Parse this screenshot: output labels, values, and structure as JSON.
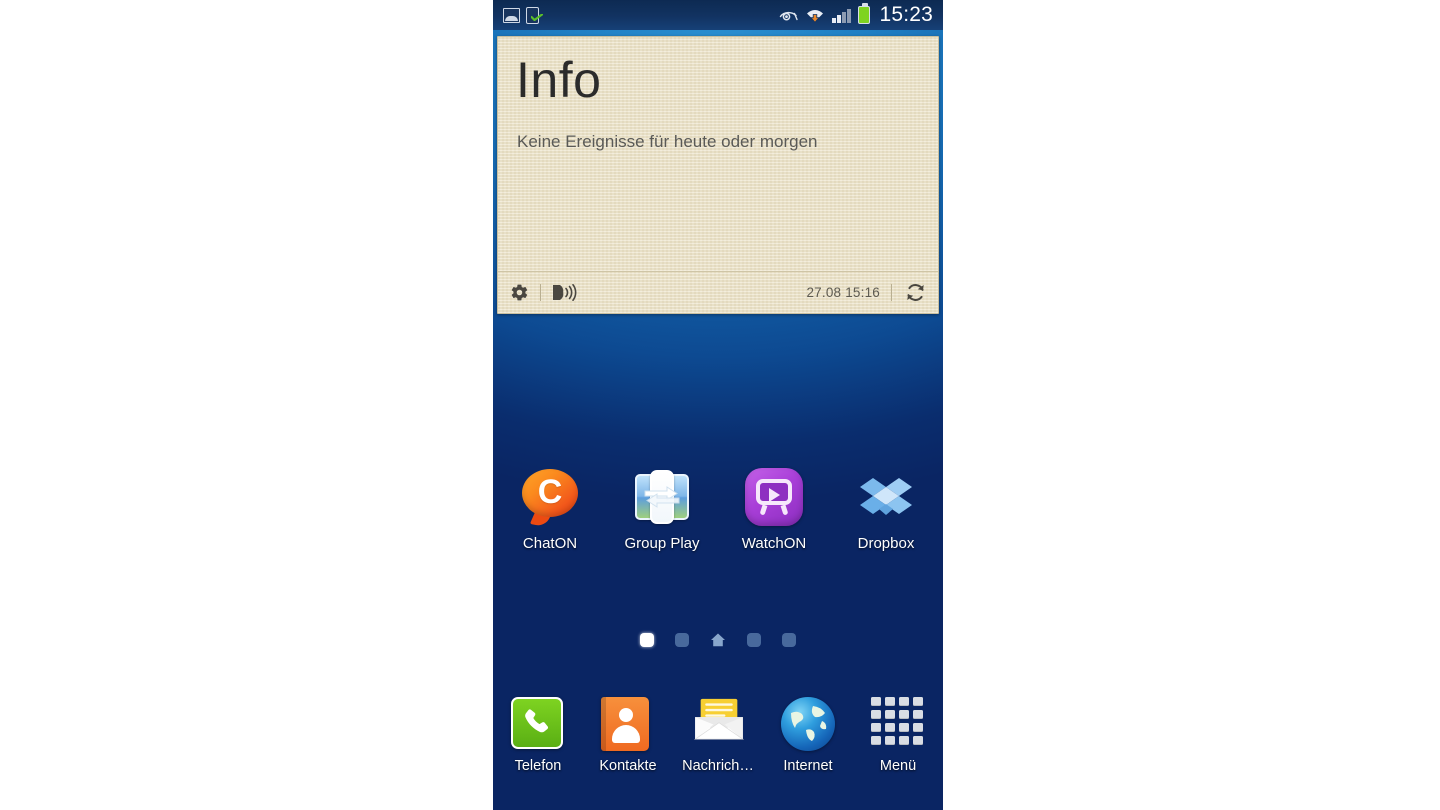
{
  "device": {
    "platform": "android-samsung-touchwiz",
    "home_screen_label": "Home screen"
  },
  "statusbar": {
    "time": "15:23",
    "left_icons": [
      {
        "name": "screenshot-captured-icon",
        "label": "Screenshot captured"
      },
      {
        "name": "device-check-icon",
        "label": "Device ready"
      }
    ],
    "right_icons": [
      {
        "name": "smart-stay-eye-icon",
        "label": "Smart stay"
      },
      {
        "name": "wifi-download-icon",
        "label": "Wi-Fi connected, downloading"
      },
      {
        "name": "signal-bars-icon",
        "label": "Signal strength",
        "bars_on": 2,
        "bars_total": 4
      },
      {
        "name": "battery-icon",
        "label": "Battery",
        "level_percent": 100
      }
    ],
    "colors": {
      "background": "#123362",
      "text": "#ffffff",
      "battery": "#7ed321"
    }
  },
  "widget": {
    "name": "info-widget",
    "title": "Info",
    "subtitle": "Keine Ereignisse für heute oder morgen",
    "footer": {
      "settings_label": "Einstellungen",
      "speak_label": "Vorlesen",
      "timestamp": "27.08 15:16",
      "refresh_label": "Aktualisieren"
    },
    "colors": {
      "paper": "#ece2c6",
      "title": "#2b2b2b",
      "subtitle": "#5a5a57",
      "border": "#c9bf9f"
    }
  },
  "apps": [
    {
      "label": "ChatON",
      "icon": "chaton-icon"
    },
    {
      "label": "Group Play",
      "icon": "group-play-icon"
    },
    {
      "label": "WatchON",
      "icon": "watchon-icon"
    },
    {
      "label": "Dropbox",
      "icon": "dropbox-icon"
    }
  ],
  "page_indicator": {
    "total": 5,
    "active_index": 0,
    "home_index": 2,
    "dots": [
      {
        "type": "active"
      },
      {
        "type": "dot"
      },
      {
        "type": "home"
      },
      {
        "type": "dot"
      },
      {
        "type": "dot"
      }
    ]
  },
  "dock": [
    {
      "label": "Telefon",
      "icon": "phone-icon"
    },
    {
      "label": "Kontakte",
      "icon": "contacts-icon"
    },
    {
      "label": "Nachrich…",
      "icon": "messages-icon"
    },
    {
      "label": "Internet",
      "icon": "internet-globe-icon"
    },
    {
      "label": "Menü",
      "icon": "app-drawer-grid-icon"
    }
  ],
  "wallpaper": {
    "top_color": "#2a8fd0",
    "bottom_color": "#0a2563"
  }
}
